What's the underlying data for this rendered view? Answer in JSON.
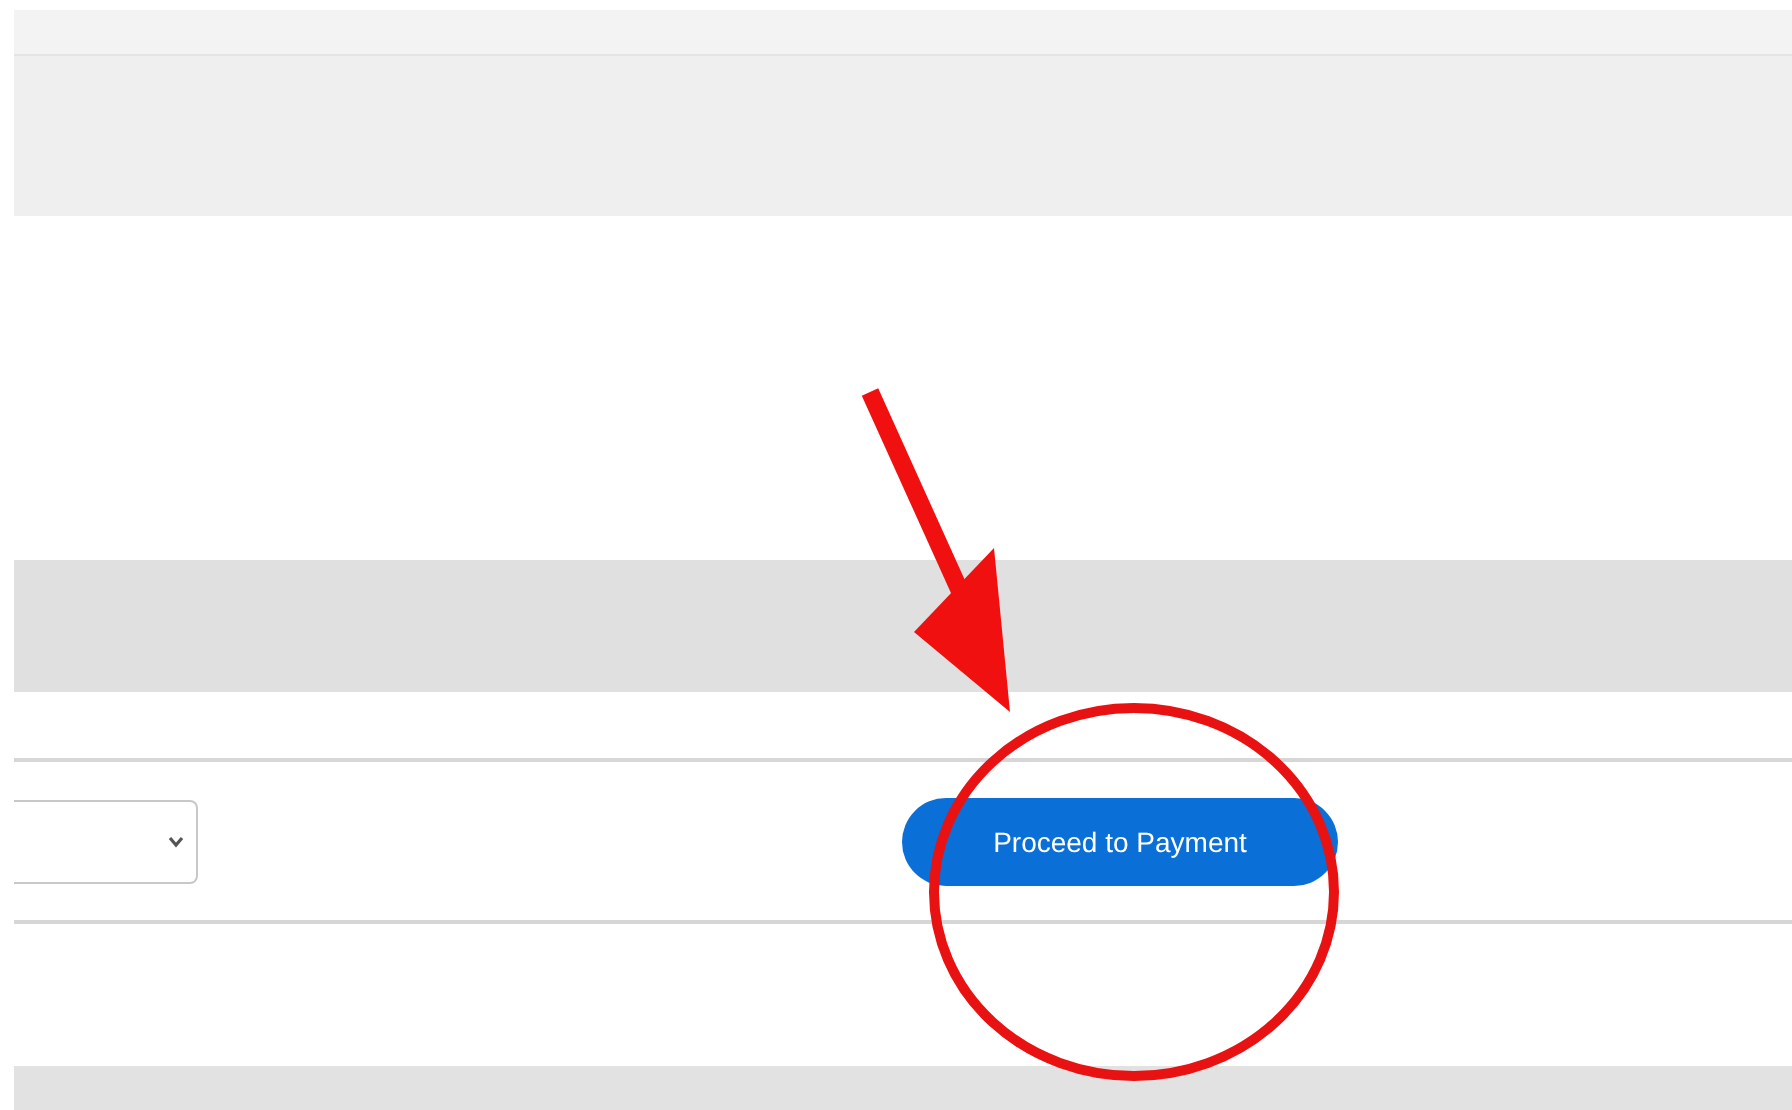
{
  "payment_row": {
    "button": {
      "label": "Proceed to Payment"
    }
  },
  "annotations": {
    "arrow": true,
    "circle": true
  }
}
